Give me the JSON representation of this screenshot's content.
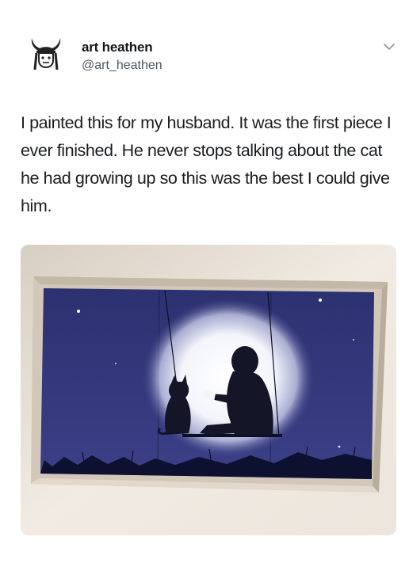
{
  "tweet": {
    "display_name": "art heathen",
    "handle": "@art_heathen",
    "text": "I painted this for my husband. It was the first piece I ever finished. He never stops talking about the cat he had growing up so this was the best I could give him.",
    "avatar_icon": "viking-helmet-avatar-icon",
    "menu_icon": "chevron-down-icon"
  },
  "colors": {
    "text": "#14171a",
    "secondary": "#4a5560",
    "wall": "#eee7de",
    "frame": "#d9cfc2",
    "night_sky": "#2a3068"
  }
}
